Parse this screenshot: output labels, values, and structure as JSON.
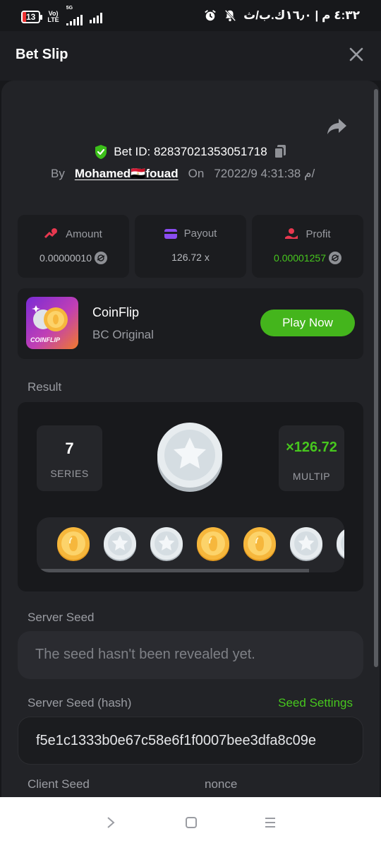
{
  "status_bar": {
    "battery": "13",
    "network_top": "Vo)",
    "network_bottom": "LTE",
    "network_5g": "5G",
    "time": "٤:٣٢ م | ١٦٫٠ك.ب/ث"
  },
  "header": {
    "title": "Bet Slip",
    "close_icon": "close-icon"
  },
  "bet": {
    "id_text": "Bet ID: 82837021353051718",
    "by_label": "By",
    "user": "Mohamed🇪🇬fouad",
    "on_label": "On",
    "date": "7م 4:31:38 2022/9/"
  },
  "stats": {
    "amount": {
      "label": "Amount",
      "value": "0.00000010"
    },
    "payout": {
      "label": "Payout",
      "value": "126.72 x"
    },
    "profit": {
      "label": "Profit",
      "value": "0.00001257"
    }
  },
  "game": {
    "name": "CoinFlip",
    "subtitle": "BC Original",
    "thumb_label": "COINFLIP",
    "play_label": "Play Now"
  },
  "result": {
    "label": "Result",
    "series_value": "7",
    "series_label": "SERIES",
    "multiplier_value": "×126.72",
    "multiplier_label": "MULTIP",
    "flips": [
      "gold",
      "silver",
      "silver",
      "gold",
      "gold",
      "silver",
      "silver"
    ]
  },
  "seeds": {
    "server_seed_label": "Server Seed",
    "server_seed_value": "The seed hasn't been revealed yet.",
    "hash_label": "Server Seed (hash)",
    "seed_settings_label": "Seed Settings",
    "hash_value": "f5e1c1333b0e67c58e6f1f0007bee3dfa8c09e",
    "client_seed_label": "Client Seed",
    "nonce_label": "nonce"
  },
  "colors": {
    "accent_green": "#47c71e",
    "play_button": "#44b51c",
    "panel_bg": "#222327",
    "card_bg": "#1b1c1f"
  }
}
